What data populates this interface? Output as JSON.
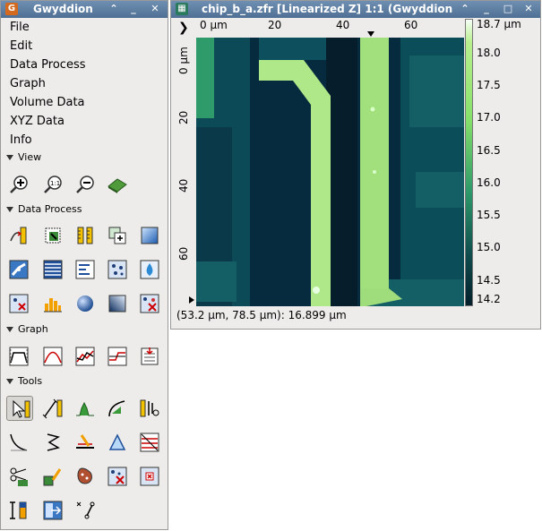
{
  "toolbox": {
    "title": "Gwyddion",
    "menu": [
      "File",
      "Edit",
      "Data Process",
      "Graph",
      "Volume Data",
      "XYZ Data",
      "Info"
    ],
    "sections": [
      "View",
      "Data Process",
      "Graph",
      "Tools"
    ]
  },
  "data_window": {
    "title": "chip_b_a.zfr [Linearized Z] 1:1 (Gwyddion",
    "x_ruler_unit": "0 µm",
    "x_ruler_labels": [
      "20",
      "40",
      "60"
    ],
    "y_ruler_unit": "0 µm",
    "y_ruler_labels": [
      "20",
      "40",
      "60"
    ],
    "scale_labels": [
      "18.7 µm",
      "18.0",
      "17.5",
      "17.0",
      "16.5",
      "16.0",
      "15.5",
      "15.0",
      "14.5",
      "14.2"
    ],
    "status": "(53.2 µm, 78.5 µm): 16.899 µm"
  },
  "colors": {
    "titlebar": "#4f6f94",
    "highlight": "#b8f08e",
    "dark": "#052133"
  }
}
